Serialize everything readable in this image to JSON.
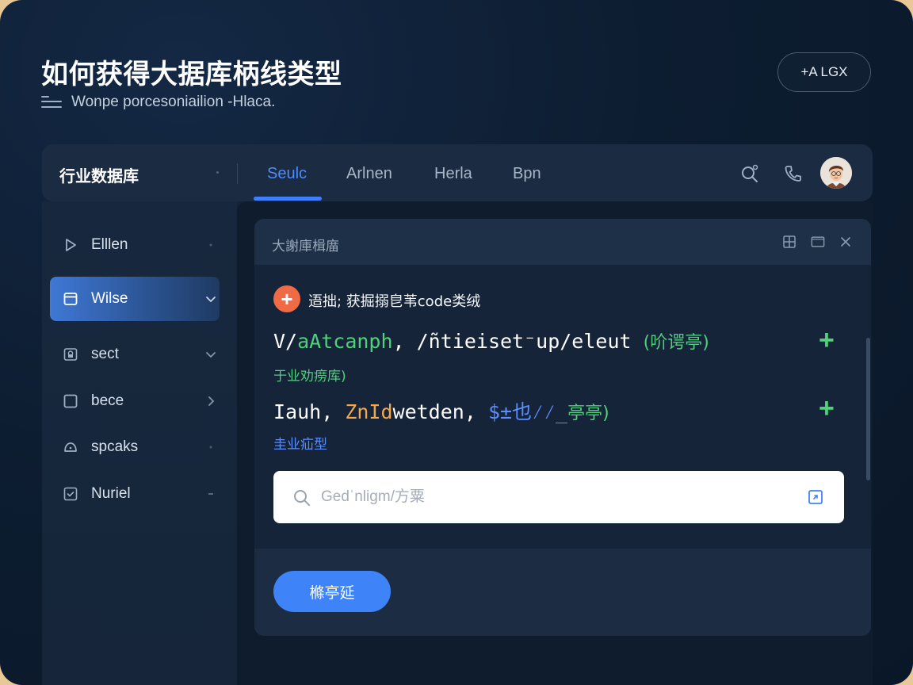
{
  "page": {
    "title": "如何获得大据库柄线类型",
    "subtitle": "Wonpe porcesoniailion -Hlaca.",
    "top_button_label": "+A LGX"
  },
  "app": {
    "brand": "行业数据库",
    "tabs": [
      {
        "label": "Seulc",
        "active": true
      },
      {
        "label": "Arlnen",
        "active": false
      },
      {
        "label": "Herla",
        "active": false
      },
      {
        "label": "Bpn",
        "active": false
      }
    ],
    "toolbar_icons": [
      "search-icon",
      "phone-icon",
      "avatar"
    ]
  },
  "sidebar": {
    "items": [
      {
        "label": "Elllen",
        "icon": "play-icon",
        "active": false,
        "chevron": "dot"
      },
      {
        "label": "Wilse",
        "icon": "window-icon",
        "active": true,
        "chevron": "down"
      },
      {
        "label": "sect",
        "icon": "lock-icon",
        "active": false,
        "chevron": "down"
      },
      {
        "label": "bece",
        "icon": "square-icon",
        "active": false,
        "chevron": "right"
      },
      {
        "label": "spcaks",
        "icon": "cloud-icon",
        "active": false,
        "chevron": "dot"
      },
      {
        "label": "Nuriel",
        "icon": "check-box-icon",
        "active": false,
        "chevron": "dash"
      }
    ]
  },
  "panel": {
    "title": "大謝庫楫庿",
    "prompt": "逜拙; 获掘搦皀苇code类绒",
    "line1": {
      "part_a": "V/",
      "part_b": "aAtcanph",
      "part_c": ", /ñtieiset⁻up/eleut ",
      "part_d": "(吤谔亭)",
      "tag": "于业劝痨库)"
    },
    "line2": {
      "part_a": "Iauh, ",
      "part_b": "ZnId",
      "part_c": "wetden, ",
      "part_d": "$±也⁄⁄_",
      "part_e": "亭亭)",
      "tag": "圭业疝型"
    },
    "search_placeholder": "Gedˈnligm/方粟",
    "primary_button": "樤亭延"
  },
  "colors": {
    "accent": "#3f83f8",
    "code_green": "#4fd17a",
    "code_orange": "#f3a94a",
    "badge_orange": "#f06a45",
    "background": "#0d1d31"
  }
}
